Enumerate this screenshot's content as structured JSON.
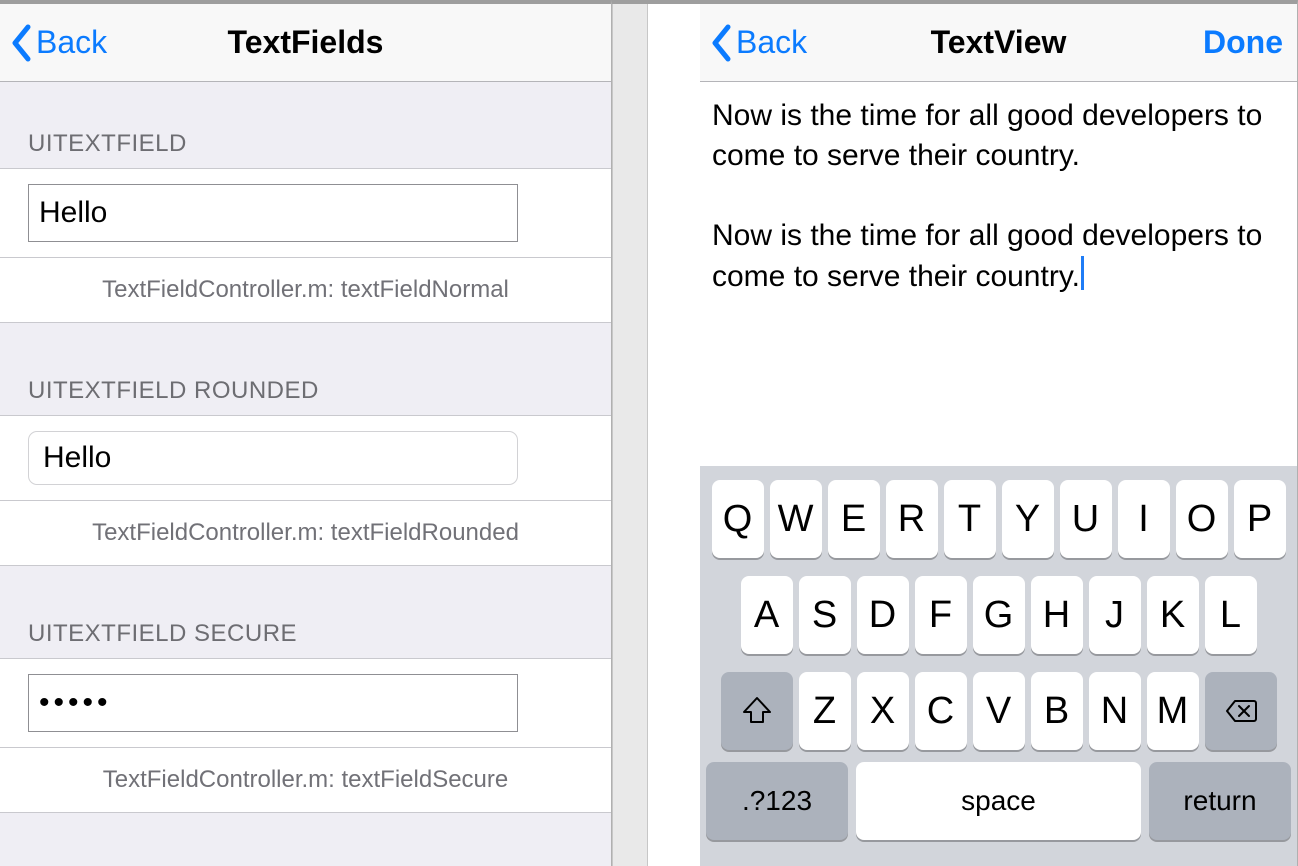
{
  "left": {
    "back_label": "Back",
    "title": "TextFields",
    "sections": {
      "normal": {
        "header": "UITEXTFIELD",
        "value": "Hello",
        "footer": "TextFieldController.m: textFieldNormal"
      },
      "rounded": {
        "header": "UITEXTFIELD ROUNDED",
        "value": "Hello",
        "footer": "TextFieldController.m: textFieldRounded"
      },
      "secure": {
        "header": "UITEXTFIELD SECURE",
        "value": "•••••",
        "footer": "TextFieldController.m: textFieldSecure"
      }
    }
  },
  "right": {
    "back_label": "Back",
    "title": "TextView",
    "done_label": "Done",
    "text": "Now is the time for all good developers to come to serve their country.\n\nNow is the time for all good developers to come to serve their country."
  },
  "keyboard": {
    "row1": [
      "Q",
      "W",
      "E",
      "R",
      "T",
      "Y",
      "U",
      "I",
      "O",
      "P"
    ],
    "row2": [
      "A",
      "S",
      "D",
      "F",
      "G",
      "H",
      "J",
      "K",
      "L"
    ],
    "row3": [
      "Z",
      "X",
      "C",
      "V",
      "B",
      "N",
      "M"
    ],
    "sym_label": ".?123",
    "space_label": "space",
    "return_label": "return"
  },
  "colors": {
    "ios_blue": "#0b7bff",
    "table_bg": "#efeef4",
    "keyboard_bg": "#d2d5db"
  }
}
